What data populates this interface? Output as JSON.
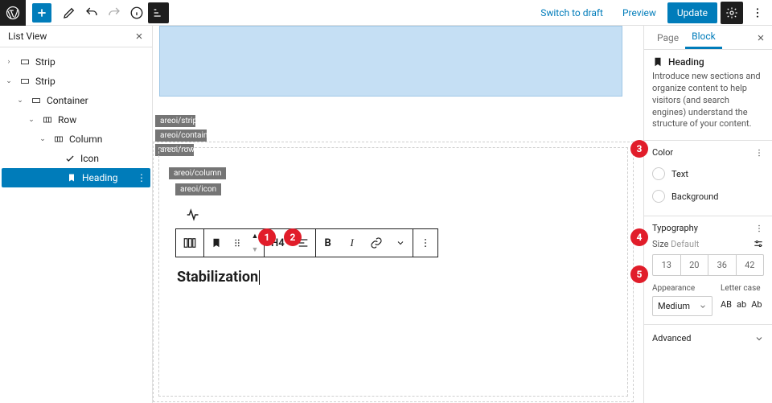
{
  "topbar": {
    "switch_draft": "Switch to draft",
    "preview": "Preview",
    "update": "Update"
  },
  "list_view": {
    "title": "List View",
    "items": [
      {
        "indent": 0,
        "toggle": "›",
        "icon": "row",
        "label": "Strip"
      },
      {
        "indent": 0,
        "toggle": "⌄",
        "icon": "row",
        "label": "Strip"
      },
      {
        "indent": 1,
        "toggle": "⌄",
        "icon": "row",
        "label": "Container"
      },
      {
        "indent": 2,
        "toggle": "⌄",
        "icon": "cols",
        "label": "Row"
      },
      {
        "indent": 3,
        "toggle": "⌄",
        "icon": "col",
        "label": "Column"
      },
      {
        "indent": 4,
        "toggle": "",
        "icon": "check",
        "label": "Icon"
      },
      {
        "indent": 4,
        "toggle": "",
        "icon": "bookmark",
        "label": "Heading",
        "selected": true
      }
    ]
  },
  "canvas": {
    "breadcrumbs": [
      "areoi/strip",
      "areoi/container",
      "areoi/row"
    ],
    "column_bc": "areoi/column",
    "icon_bc": "areoi/icon",
    "heading_level": "H4",
    "heading_text": "Stabilization"
  },
  "inspector": {
    "tabs": {
      "page": "Page",
      "block": "Block"
    },
    "block": {
      "title": "Heading",
      "desc": "Introduce new sections and organize content to help visitors (and search engines) understand the structure of your content."
    },
    "color": {
      "title": "Color",
      "text": "Text",
      "background": "Background"
    },
    "typography": {
      "title": "Typography",
      "size_label": "Size",
      "size_default": "Default",
      "sizes": [
        "13",
        "20",
        "36",
        "42"
      ],
      "appearance_label": "Appearance",
      "appearance_value": "Medium",
      "lettercase_label": "Letter case",
      "lettercase_opts": [
        "AB",
        "ab",
        "Ab"
      ]
    },
    "advanced": "Advanced"
  },
  "markers": {
    "1": "1",
    "2": "2",
    "3": "3",
    "4": "4",
    "5": "5"
  }
}
